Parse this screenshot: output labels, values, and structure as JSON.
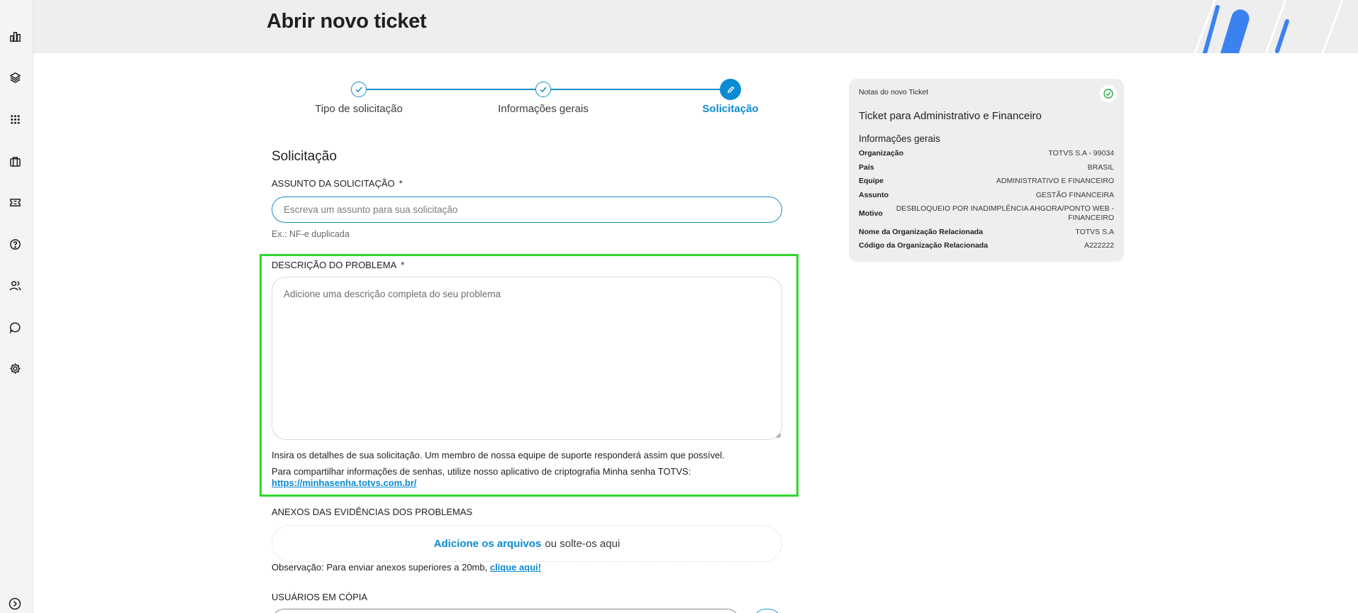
{
  "header": {
    "title": "Abrir novo ticket"
  },
  "sidebar": {
    "items": [
      {
        "icon": "dashboard-icon"
      },
      {
        "icon": "layers-icon"
      },
      {
        "icon": "apps-grid-icon"
      },
      {
        "icon": "briefcase-icon"
      },
      {
        "icon": "ticket-icon"
      },
      {
        "icon": "help-icon"
      },
      {
        "icon": "users-icon"
      },
      {
        "icon": "chat-icon"
      },
      {
        "icon": "settings-icon"
      }
    ],
    "expand_icon": "expand-icon"
  },
  "stepper": {
    "steps": [
      {
        "label": "Tipo de solicitação",
        "status": "done"
      },
      {
        "label": "Informações gerais",
        "status": "done"
      },
      {
        "label": "Solicitação",
        "status": "active"
      }
    ]
  },
  "form": {
    "section_title": "Solicitação",
    "subject": {
      "label": "ASSUNTO DA SOLICITAÇÃO",
      "required_mark": "*",
      "placeholder": "Escreva um assunto para sua solicitação",
      "hint": "Ex.: NF-e duplicada"
    },
    "description": {
      "label": "DESCRIÇÃO DO PROBLEMA",
      "required_mark": "*",
      "placeholder": "Adicione uma descrição completa do seu problema",
      "help_text": "Insira os detalhes de sua solicitação. Um membro de nossa equipe de suporte responderá assim que possível.",
      "password_text": "Para compartilhar informações de senhas, utilize nosso aplicativo de criptografia Minha senha TOTVS:",
      "password_link": "https://minhasenha.totvs.com.br/"
    },
    "attachments": {
      "label": "ANEXOS DAS EVIDÊNCIAS DOS PROBLEMAS",
      "add_link": "Adicione os arquivos",
      "drop_text": "ou solte-os aqui",
      "note": "Observação: Para enviar anexos superiores a 20mb,",
      "note_link": "clique aqui!"
    },
    "cc_users": {
      "label": "USUÁRIOS EM CÓPIA"
    }
  },
  "notes": {
    "header": "Notas do novo Ticket",
    "title": "Ticket para Administrativo e Financeiro",
    "section": "Informações gerais",
    "rows": [
      {
        "key": "Organização",
        "value": "TOTVS S.A - 99034"
      },
      {
        "key": "País",
        "value": "BRASIL"
      },
      {
        "key": "Equipe",
        "value": "ADMINISTRATIVO E FINANCEIRO"
      },
      {
        "key": "Assunto",
        "value": "GESTÃO FINANCEIRA"
      },
      {
        "key": "Motivo",
        "value": "DESBLOQUEIO POR INADIMPLÊNCIA AHGORA/PONTO WEB - FINANCEIRO"
      },
      {
        "key": "Nome da Organização Relacionada",
        "value": "TOTVS S.A"
      },
      {
        "key": "Código da Organização Relacionada",
        "value": "A222222"
      }
    ]
  },
  "colors": {
    "accent": "#0b8bd4",
    "highlight": "#2fd82a",
    "header_bg": "#eeeeee",
    "deco_blue": "#3b82f0"
  }
}
